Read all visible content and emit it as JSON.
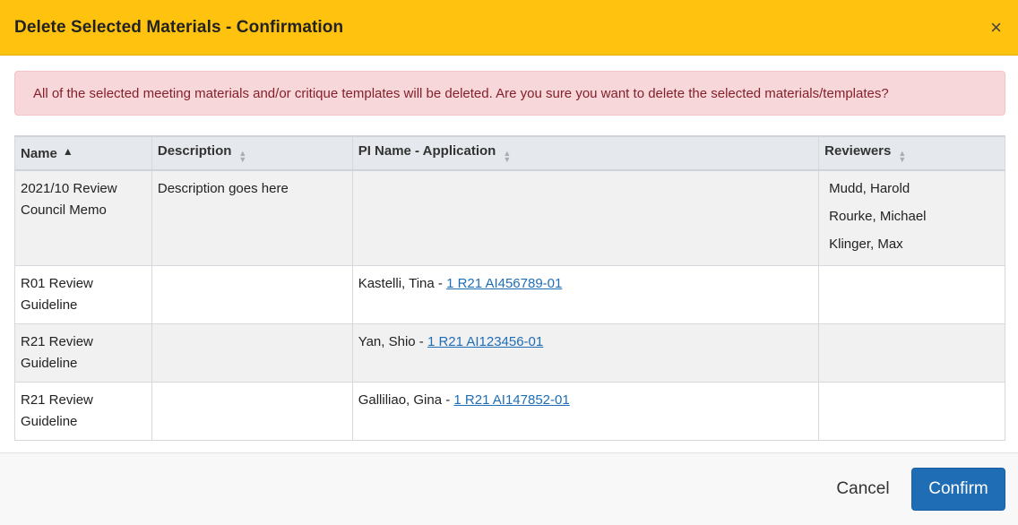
{
  "dialog": {
    "title": "Delete Selected Materials - Confirmation",
    "close_glyph": "×"
  },
  "alert": {
    "message": "All of the selected meeting materials and/or critique templates will be deleted. Are you sure you want to delete the selected materials/templates?"
  },
  "table": {
    "headers": {
      "name": "Name",
      "description": "Description",
      "pi_application": "PI Name - Application",
      "reviewers": "Reviewers"
    },
    "sort": {
      "column": "name",
      "direction": "ascending"
    },
    "rows": [
      {
        "name": "2021/10 Review Council Memo",
        "description": "Description goes here",
        "pi_name": "",
        "separator": "",
        "application": "",
        "reviewers": [
          "Mudd, Harold",
          "Rourke, Michael",
          "Klinger, Max"
        ]
      },
      {
        "name": "R01 Review Guideline",
        "description": "",
        "pi_name": "Kastelli, Tina",
        "separator": " - ",
        "application": "1 R21 AI456789-01",
        "reviewers": []
      },
      {
        "name": "R21 Review Guideline",
        "description": "",
        "pi_name": "Yan, Shio",
        "separator": " - ",
        "application": "1 R21 AI123456-01",
        "reviewers": []
      },
      {
        "name": "R21 Review Guideline",
        "description": "",
        "pi_name": "Galliliao, Gina",
        "separator": " - ",
        "application": "1 R21 AI147852-01",
        "reviewers": []
      }
    ]
  },
  "footer": {
    "cancel_label": "Cancel",
    "confirm_label": "Confirm"
  },
  "colors": {
    "header_bg": "#ffc20e",
    "alert_bg": "#f8d7da",
    "alert_text": "#842029",
    "link": "#1f6db5",
    "primary_button": "#1f6db5"
  },
  "icons": {
    "close": "close-icon",
    "sort_asc": "sort-ascending-icon",
    "sort_both": "sort-unsorted-icon"
  }
}
